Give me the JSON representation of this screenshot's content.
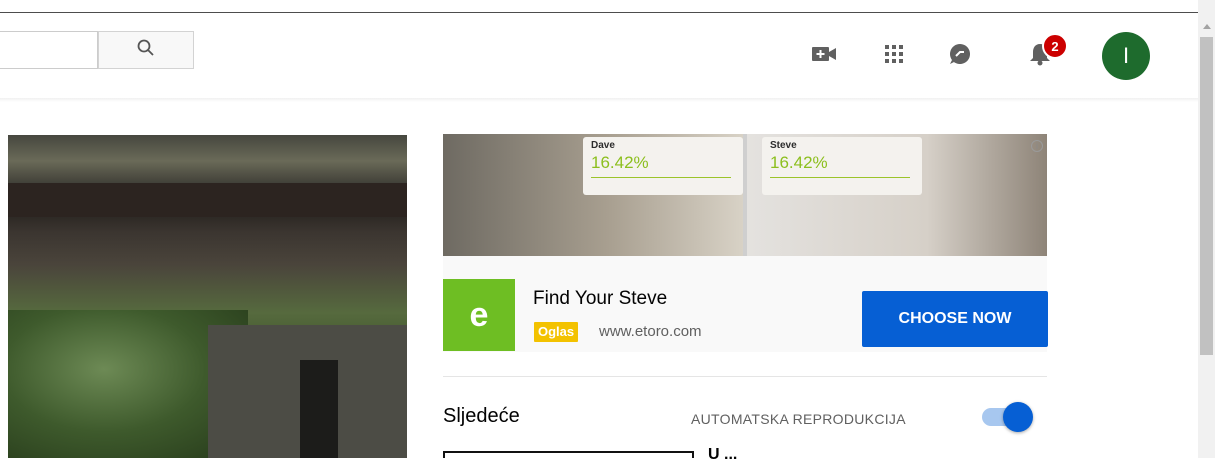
{
  "header": {
    "search": {
      "value": "",
      "placeholder": ""
    },
    "notifications": {
      "count": "2"
    },
    "avatar": {
      "initial": "I",
      "color": "#1e6b2d"
    },
    "icons": [
      "search-icon",
      "create-video-icon",
      "apps-icon",
      "messages-icon",
      "notifications-bell-icon"
    ]
  },
  "ad": {
    "banner": {
      "left_name": "Dave",
      "left_pct": "16.42%",
      "right_name": "Steve",
      "right_pct": "16.42%"
    },
    "info_glyph": "i",
    "logo_letter": "e",
    "title": "Find Your Steve",
    "badge": "Oglas",
    "url": "www.etoro.com",
    "cta": "CHOOSE NOW",
    "colors": {
      "cta": "#065fd4",
      "logo": "#6ebe23",
      "badge": "#f3c200"
    }
  },
  "up_next": {
    "title": "Sljedeće",
    "autoplay_label": "AUTOMATSKA REPRODUKCIJA",
    "autoplay_on": true,
    "first_item_title_partial": "U ..."
  }
}
